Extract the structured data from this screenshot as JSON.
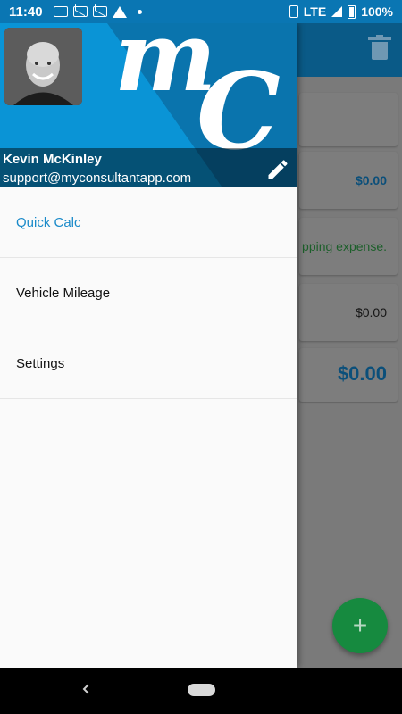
{
  "status_bar": {
    "time": "11:40",
    "network": "LTE",
    "battery": "100%"
  },
  "drawer": {
    "user_name": "Kevin McKinley",
    "user_email": "support@myconsultantapp.com",
    "logo_text": "mC",
    "menu_items": [
      {
        "label": "Quick Calc",
        "active": true
      },
      {
        "label": "Vehicle Mileage",
        "active": false
      },
      {
        "label": "Settings",
        "active": false
      }
    ]
  },
  "background": {
    "amount_1": "$0.00",
    "expense_text": "pping expense.",
    "amount_2": "$0.00",
    "total": "$0.00"
  },
  "fab": {
    "label": "+"
  },
  "colors": {
    "accent": "#0a94d6",
    "fab": "#168a3f",
    "active_menu": "#1a8ac9"
  }
}
